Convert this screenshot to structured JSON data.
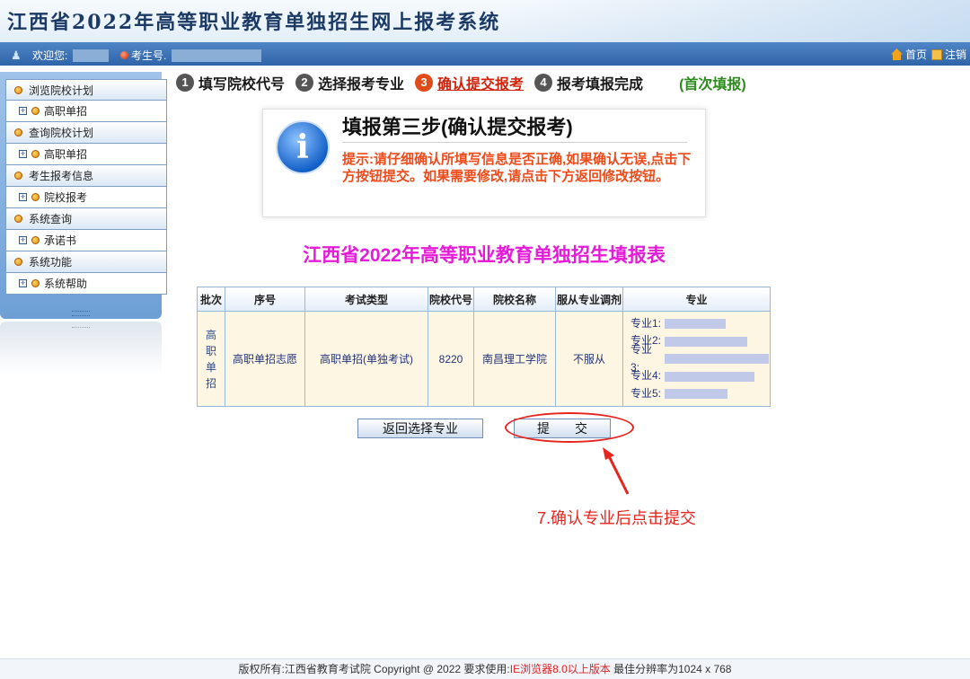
{
  "header": {
    "title": "江西省2022年高等职业教育单独招生网上报考系统"
  },
  "welcome_bar": {
    "welcome_label": "欢迎您:",
    "exam_no_label": "考生号.",
    "home_link": "首页",
    "logout_link": "注销"
  },
  "sidebar": {
    "groups": [
      {
        "label": "浏览院校计划",
        "items": [
          {
            "label": "高职单招"
          }
        ]
      },
      {
        "label": "查询院校计划",
        "items": [
          {
            "label": "高职单招"
          }
        ]
      },
      {
        "label": "考生报考信息",
        "items": [
          {
            "label": "院校报考"
          }
        ]
      },
      {
        "label": "系统查询",
        "items": [
          {
            "label": "承诺书"
          }
        ]
      },
      {
        "label": "系统功能",
        "items": [
          {
            "label": "系统帮助"
          }
        ]
      }
    ]
  },
  "steps": [
    {
      "num": "1",
      "label": "填写院校代号"
    },
    {
      "num": "2",
      "label": "选择报考专业"
    },
    {
      "num": "3",
      "label": "确认提交报考"
    },
    {
      "num": "4",
      "label": "报考填报完成"
    }
  ],
  "first_fill": "(首次填报)",
  "info": {
    "icon": "info-icon",
    "heading": "填报第三步(确认提交报考)",
    "tip": "提示:请仔细确认所填写信息是否正确,如果确认无误,点击下方按钮提交。如果需要修改,请点击下方返回修改按钮。"
  },
  "form_title": "江西省2022年高等职业教育单独招生填报表",
  "table": {
    "headers": [
      "批次",
      "序号",
      "考试类型",
      "院校代号",
      "院校名称",
      "服从专业调剂",
      "专业"
    ],
    "row": {
      "batch": "高职单招",
      "seq": "高职单招志愿",
      "exam_type": "高职单招(单独考试)",
      "school_code": "8220",
      "school_name": "南昌理工学院",
      "adjust": "不服从",
      "majors": [
        "专业1:",
        "专业2:",
        "专业3:",
        "专业4:",
        "专业5:"
      ]
    }
  },
  "buttons": {
    "back": "返回选择专业",
    "submit": "提　　交"
  },
  "annotation": "7.确认专业后点击提交",
  "footer": {
    "prefix": "版权所有:江西省教育考试院 Copyright @ 2022 要求使用:",
    "browser": "IE浏览器8.0以上版本",
    "suffix": " 最佳分辨率为1024 x 768"
  },
  "colors": {
    "accent_red": "#e8241e",
    "title_magenta": "#e51bd8",
    "bar_blue": "#2f64a8"
  }
}
